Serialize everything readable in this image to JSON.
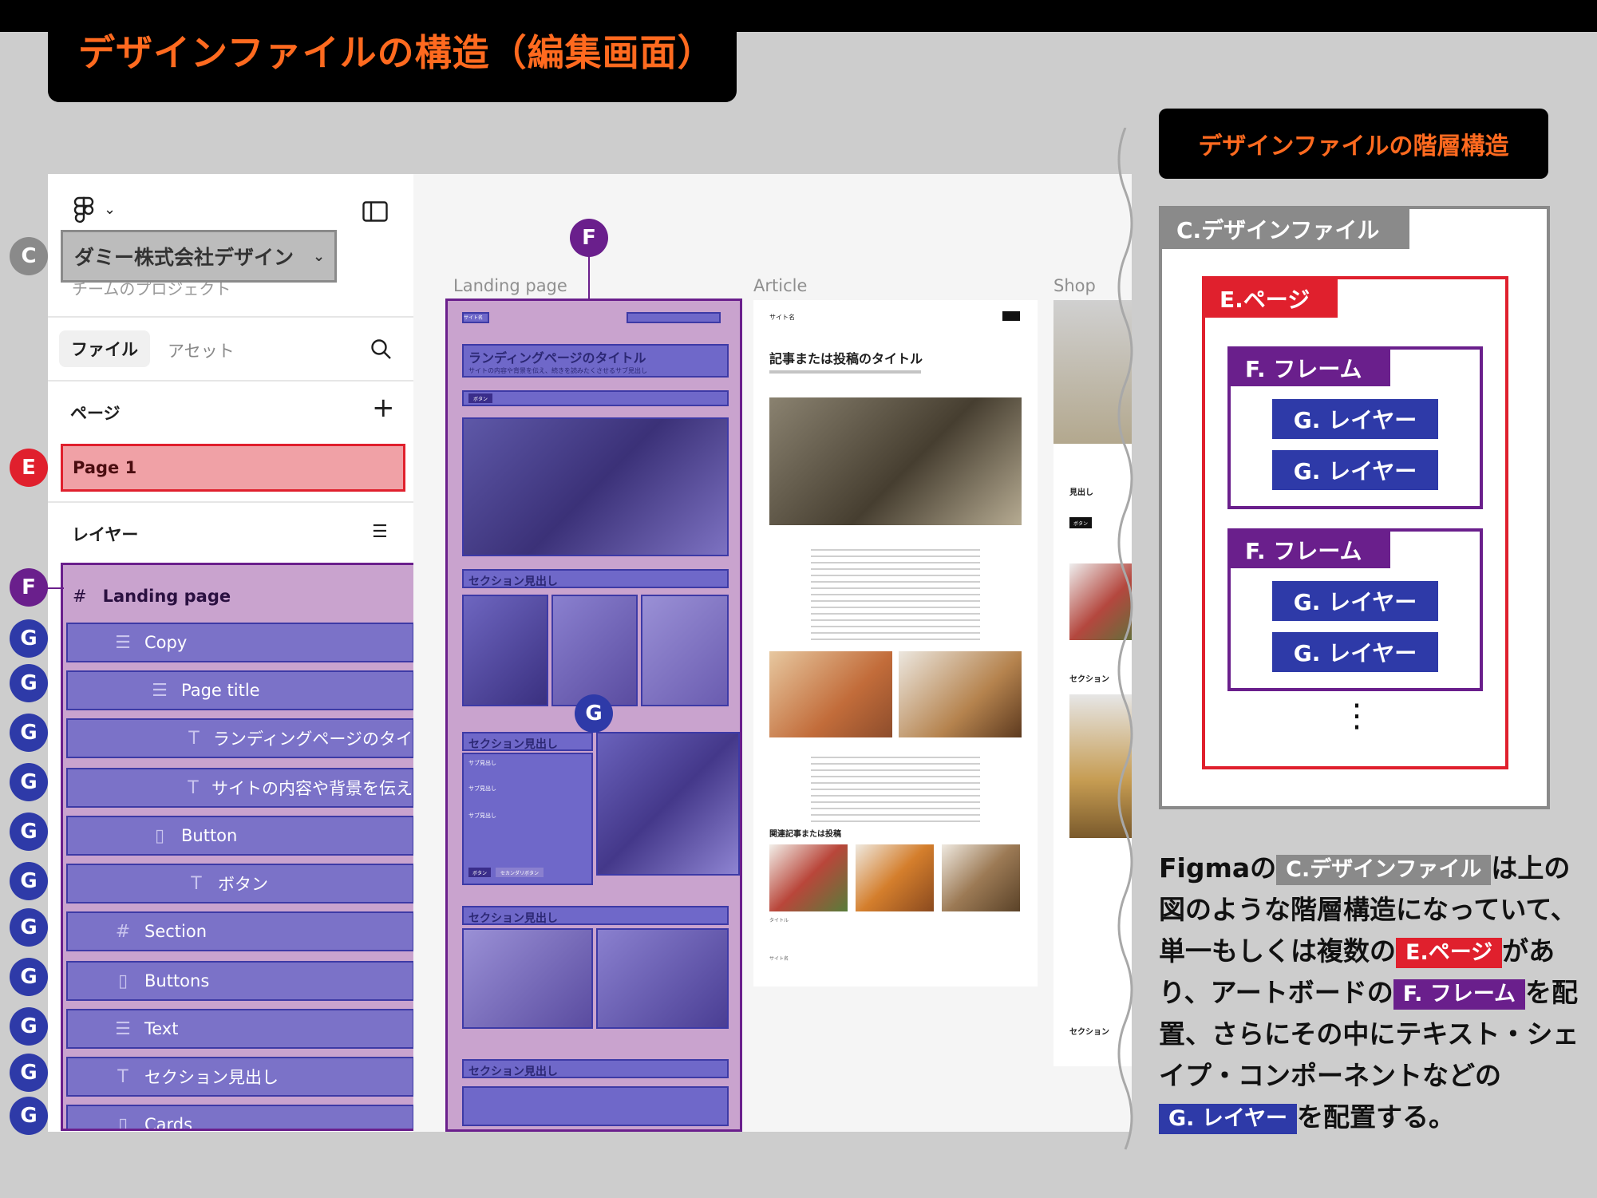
{
  "heading": "デザインファイルの構造（編集画面）",
  "sidebar": {
    "file_name": "ダミー株式会社デザイン",
    "team_project": "チームのプロジェクト",
    "tab_file": "ファイル",
    "tab_assets": "アセット",
    "pages_header": "ページ",
    "page_item": "Page 1",
    "layers_header": "レイヤー",
    "layers": [
      {
        "icon": "#",
        "label": "Landing page"
      },
      {
        "icon": "☰",
        "label": "Copy"
      },
      {
        "icon": "☰",
        "label": "Page title"
      },
      {
        "icon": "T",
        "label": "ランディングページのタイ"
      },
      {
        "icon": "T",
        "label": "サイトの内容や背景を伝え"
      },
      {
        "icon": "▯",
        "label": "Button"
      },
      {
        "icon": "T",
        "label": "ボタン"
      },
      {
        "icon": "#",
        "label": "Section"
      },
      {
        "icon": "▯",
        "label": "Buttons"
      },
      {
        "icon": "☰",
        "label": "Text"
      },
      {
        "icon": "T",
        "label": "セクション見出し"
      },
      {
        "icon": "▯",
        "label": "Cards"
      }
    ]
  },
  "markers": {
    "c": "C",
    "e": "E",
    "f": "F",
    "g": "G"
  },
  "canvas": {
    "frames": [
      "Landing page",
      "Article",
      "Shop"
    ],
    "landing": {
      "nav_site": "サイト名",
      "title": "ランディングページのタイトル",
      "subtitle": "サイトの内容や背景を伝え、続きを読みたくさせるサブ見出し",
      "button": "ボタン",
      "section_heading": "セクション見出し",
      "sub_heading": "サブ見出し",
      "button2": "セカンダリボタン"
    },
    "article": {
      "site": "サイト名",
      "title": "記事または投稿のタイトル",
      "related": "関連記事または投稿",
      "card_title": "タイトル"
    },
    "shop": {
      "heading": "見出し",
      "section": "セクション",
      "button": "ボタン"
    }
  },
  "hierarchy": {
    "title": "デザインファイルの階層構造",
    "design_file": "C.デザインファイル",
    "page": "E.ページ",
    "frame": "F. フレーム",
    "layer": "G. レイヤー",
    "ellipsis": "⋮"
  },
  "description": {
    "p1": "Figmaの",
    "p2": "は上の図のような階層構造になっていて、単一もしくは複数の",
    "p3": "があり、アートボードの",
    "p4": "を配置、さらにその中にテキスト・シェイプ・コンポーネントなどの",
    "p5": "を配置する。"
  },
  "colors": {
    "orange": "#ff6a1f",
    "design_file_gray": "#8a8a8a",
    "page_red": "#e0202d",
    "frame_purple": "#6a1f8c",
    "layer_blue": "#2e3aa8"
  }
}
